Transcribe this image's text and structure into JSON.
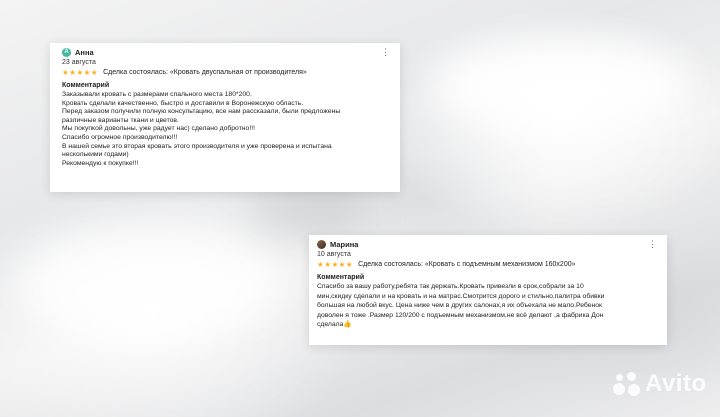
{
  "reviews": [
    {
      "author": "Анна",
      "avatar_letter": "А",
      "date": "23 августа",
      "rating": 5,
      "deal": "Сделка состоялась: «Кровать двуспальная от производителя»",
      "comment_title": "Комментарий",
      "comment_lines": [
        "Заказывали кровать с размерами спального места 180*200.",
        "Кровать сделали качественно, быстро и доставили в Воронежскую область.",
        "Перед заказом получили полную консультацию, все нам рассказали, были предложены",
        "различные варианты ткани и цветов.",
        "Мы покупкой довольны, уже радует нас) сделано добротно!!!",
        "Спасибо огромное производителю!!!",
        "В нашей семье это вторая кровать этого производителя и уже проверена и испытана",
        "несколькими годами)",
        "Рекомендую к покупке!!!"
      ]
    },
    {
      "author": "Марина",
      "date": "10 августа",
      "rating": 5,
      "deal": "Сделка состоялась: «Кровать с подъемным механизмом 160х200»",
      "comment_title": "Комментарий",
      "comment_lines": [
        "Спасибо за вашу работу,ребята так держать.Кровать привезли в срок,собрали за 10",
        "мин,скидку сделали и на кровать и на матрас.Смотрится дорого и стильно,палитра обивки",
        "большая на любой вкус. Цена ниже чем в других салонах,я их объехала не мало.Ребенок",
        "доволен я тоже .Размер 120/200 с подъемным механизмом,не всё делают ,а фабрика Дон",
        "сделала👍"
      ]
    }
  ],
  "stars_glyph": "★★★★★",
  "menu_glyph": "⋮",
  "watermark": "Avito",
  "colors": {
    "star": "#ffb021",
    "avatar_anna": "#3fb8a0"
  }
}
